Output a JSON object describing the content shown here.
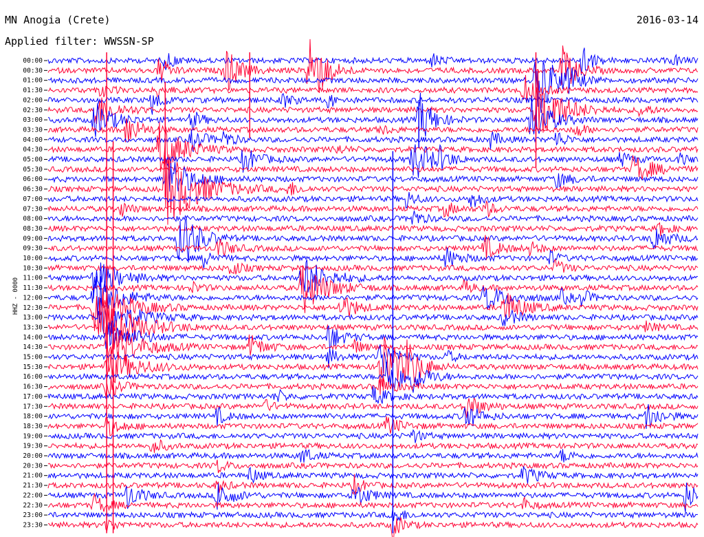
{
  "header": {
    "station": "MN Anogia (Crete)",
    "filter": "Applied filter: WWSSN-SP",
    "date": "2016-03-14",
    "channel": "HHZ - 0000"
  },
  "colors": {
    "odd_row": "#0000ff",
    "even_row": "#ff0033"
  },
  "chart_data": {
    "type": "line",
    "title": "MN Anogia (Crete)",
    "subtitle": "Applied filter: WWSSN-SP",
    "ylabel": "HHZ - 0000",
    "xlabel": "",
    "row_labels": [
      "00:00",
      "00:30",
      "01:00",
      "01:30",
      "02:00",
      "02:30",
      "03:00",
      "03:30",
      "04:00",
      "04:30",
      "05:00",
      "05:30",
      "06:00",
      "06:30",
      "07:00",
      "07:30",
      "08:00",
      "08:30",
      "09:00",
      "09:30",
      "10:00",
      "10:30",
      "11:00",
      "11:30",
      "12:00",
      "12:30",
      "13:00",
      "13:30",
      "14:00",
      "14:30",
      "15:00",
      "15:30",
      "16:00",
      "16:30",
      "17:00",
      "17:30",
      "18:00",
      "18:30",
      "19:00",
      "19:30",
      "20:00",
      "20:30",
      "21:00",
      "21:30",
      "22:00",
      "22:30",
      "23:00",
      "23:30"
    ],
    "row_minutes": 30,
    "series_colors": [
      "#0000ff",
      "#ff0033"
    ],
    "events": [
      {
        "row": 0,
        "t": 0.82,
        "amp": 28,
        "len": 0.02
      },
      {
        "row": 0,
        "t": 0.18,
        "amp": 14,
        "len": 0.02
      },
      {
        "row": 0,
        "t": 0.59,
        "amp": 10,
        "len": 0.02
      },
      {
        "row": 0,
        "t": 0.96,
        "amp": 8,
        "len": 0.02
      },
      {
        "row": 1,
        "t": 0.27,
        "amp": 40,
        "len": 0.03
      },
      {
        "row": 1,
        "t": 0.4,
        "amp": 80,
        "len": 0.03
      },
      {
        "row": 1,
        "t": 0.17,
        "amp": 22,
        "len": 0.02
      },
      {
        "row": 1,
        "t": 0.79,
        "amp": 36,
        "len": 0.03
      },
      {
        "row": 2,
        "t": 0.75,
        "amp": 60,
        "len": 0.04
      },
      {
        "row": 2,
        "t": 0.8,
        "amp": 16,
        "len": 0.02
      },
      {
        "row": 3,
        "t": 0.08,
        "amp": 10,
        "len": 0.02
      },
      {
        "row": 3,
        "t": 0.17,
        "amp": 10,
        "len": 0.02
      },
      {
        "row": 3,
        "t": 0.73,
        "amp": 24,
        "len": 0.03
      },
      {
        "row": 4,
        "t": 0.16,
        "amp": 20,
        "len": 0.02
      },
      {
        "row": 4,
        "t": 0.36,
        "amp": 12,
        "len": 0.02
      },
      {
        "row": 4,
        "t": 0.43,
        "amp": 10,
        "len": 0.02
      },
      {
        "row": 5,
        "t": 0.07,
        "amp": 28,
        "len": 0.04
      },
      {
        "row": 5,
        "t": 0.75,
        "amp": 62,
        "len": 0.05
      },
      {
        "row": 5,
        "t": 0.91,
        "amp": 10,
        "len": 0.02
      },
      {
        "row": 6,
        "t": 0.07,
        "amp": 28,
        "len": 0.04
      },
      {
        "row": 6,
        "t": 0.22,
        "amp": 16,
        "len": 0.02
      },
      {
        "row": 6,
        "t": 0.74,
        "amp": 40,
        "len": 0.04
      },
      {
        "row": 6,
        "t": 0.57,
        "amp": 40,
        "len": 0.03
      },
      {
        "row": 7,
        "t": 0.12,
        "amp": 24,
        "len": 0.03
      },
      {
        "row": 7,
        "t": 0.51,
        "amp": 8,
        "len": 0.02
      },
      {
        "row": 7,
        "t": 0.81,
        "amp": 12,
        "len": 0.02
      },
      {
        "row": 8,
        "t": 0.22,
        "amp": 16,
        "len": 0.03
      },
      {
        "row": 8,
        "t": 0.27,
        "amp": 12,
        "len": 0.02
      },
      {
        "row": 8,
        "t": 0.68,
        "amp": 12,
        "len": 0.02
      },
      {
        "row": 8,
        "t": 0.78,
        "amp": 14,
        "len": 0.02
      },
      {
        "row": 9,
        "t": 0.17,
        "amp": 40,
        "len": 0.05
      },
      {
        "row": 9,
        "t": 0.44,
        "amp": 8,
        "len": 0.02
      },
      {
        "row": 10,
        "t": 0.3,
        "amp": 20,
        "len": 0.03
      },
      {
        "row": 10,
        "t": 0.56,
        "amp": 34,
        "len": 0.04
      },
      {
        "row": 10,
        "t": 0.6,
        "amp": 14,
        "len": 0.02
      },
      {
        "row": 10,
        "t": 0.88,
        "amp": 12,
        "len": 0.02
      },
      {
        "row": 10,
        "t": 0.97,
        "amp": 8,
        "len": 0.02
      },
      {
        "row": 11,
        "t": 0.9,
        "amp": 22,
        "len": 0.04
      },
      {
        "row": 12,
        "t": 0.18,
        "amp": 40,
        "len": 0.05
      },
      {
        "row": 12,
        "t": 0.78,
        "amp": 12,
        "len": 0.03
      },
      {
        "row": 13,
        "t": 0.18,
        "amp": 60,
        "len": 0.07
      },
      {
        "row": 13,
        "t": 0.37,
        "amp": 12,
        "len": 0.02
      },
      {
        "row": 14,
        "t": 0.55,
        "amp": 14,
        "len": 0.02
      },
      {
        "row": 14,
        "t": 0.65,
        "amp": 14,
        "len": 0.02
      },
      {
        "row": 15,
        "t": 0.11,
        "amp": 12,
        "len": 0.02
      },
      {
        "row": 15,
        "t": 0.61,
        "amp": 12,
        "len": 0.02
      },
      {
        "row": 15,
        "t": 0.67,
        "amp": 14,
        "len": 0.02
      },
      {
        "row": 16,
        "t": 0.56,
        "amp": 14,
        "len": 0.02
      },
      {
        "row": 17,
        "t": 0.94,
        "amp": 10,
        "len": 0.02
      },
      {
        "row": 18,
        "t": 0.2,
        "amp": 30,
        "len": 0.04
      },
      {
        "row": 18,
        "t": 0.21,
        "amp": 22,
        "len": 0.03
      },
      {
        "row": 18,
        "t": 0.93,
        "amp": 20,
        "len": 0.03
      },
      {
        "row": 19,
        "t": 0.26,
        "amp": 14,
        "len": 0.03
      },
      {
        "row": 19,
        "t": 0.67,
        "amp": 18,
        "len": 0.03
      },
      {
        "row": 19,
        "t": 0.74,
        "amp": 10,
        "len": 0.02
      },
      {
        "row": 20,
        "t": 0.24,
        "amp": 14,
        "len": 0.02
      },
      {
        "row": 20,
        "t": 0.61,
        "amp": 16,
        "len": 0.03
      },
      {
        "row": 20,
        "t": 0.77,
        "amp": 10,
        "len": 0.02
      },
      {
        "row": 21,
        "t": 0.28,
        "amp": 14,
        "len": 0.02
      },
      {
        "row": 21,
        "t": 0.78,
        "amp": 12,
        "len": 0.02
      },
      {
        "row": 22,
        "t": 0.39,
        "amp": 34,
        "len": 0.05
      },
      {
        "row": 22,
        "t": 0.07,
        "amp": 30,
        "len": 0.05
      },
      {
        "row": 23,
        "t": 0.39,
        "amp": 40,
        "len": 0.05
      },
      {
        "row": 23,
        "t": 0.22,
        "amp": 8,
        "len": 0.02
      },
      {
        "row": 23,
        "t": 0.64,
        "amp": 10,
        "len": 0.02
      },
      {
        "row": 24,
        "t": 0.07,
        "amp": 40,
        "len": 0.05
      },
      {
        "row": 24,
        "t": 0.67,
        "amp": 20,
        "len": 0.05
      },
      {
        "row": 24,
        "t": 0.79,
        "amp": 10,
        "len": 0.02
      },
      {
        "row": 24,
        "t": 0.82,
        "amp": 12,
        "len": 0.02
      },
      {
        "row": 25,
        "t": 0.07,
        "amp": 50,
        "len": 0.06
      },
      {
        "row": 25,
        "t": 0.45,
        "amp": 22,
        "len": 0.03
      },
      {
        "row": 25,
        "t": 0.7,
        "amp": 26,
        "len": 0.04
      },
      {
        "row": 26,
        "t": 0.08,
        "amp": 40,
        "len": 0.06
      },
      {
        "row": 26,
        "t": 0.7,
        "amp": 14,
        "len": 0.03
      },
      {
        "row": 27,
        "t": 0.08,
        "amp": 50,
        "len": 0.07
      },
      {
        "row": 27,
        "t": 0.92,
        "amp": 8,
        "len": 0.02
      },
      {
        "row": 28,
        "t": 0.43,
        "amp": 20,
        "len": 0.03
      },
      {
        "row": 28,
        "t": 0.09,
        "amp": 30,
        "len": 0.05
      },
      {
        "row": 29,
        "t": 0.31,
        "amp": 18,
        "len": 0.03
      },
      {
        "row": 29,
        "t": 0.47,
        "amp": 10,
        "len": 0.02
      },
      {
        "row": 29,
        "t": 0.09,
        "amp": 40,
        "len": 0.06
      },
      {
        "row": 30,
        "t": 0.43,
        "amp": 14,
        "len": 0.02
      },
      {
        "row": 30,
        "t": 0.61,
        "amp": 10,
        "len": 0.02
      },
      {
        "row": 30,
        "t": 0.51,
        "amp": 30,
        "len": 0.03
      },
      {
        "row": 31,
        "t": 0.09,
        "amp": 30,
        "len": 0.06
      },
      {
        "row": 31,
        "t": 0.51,
        "amp": 60,
        "len": 0.04
      },
      {
        "row": 31,
        "t": 0.55,
        "amp": 30,
        "len": 0.03
      },
      {
        "row": 32,
        "t": 0.52,
        "amp": 30,
        "len": 0.04
      },
      {
        "row": 32,
        "t": 0.56,
        "amp": 18,
        "len": 0.03
      },
      {
        "row": 33,
        "t": 0.09,
        "amp": 16,
        "len": 0.03
      },
      {
        "row": 33,
        "t": 0.51,
        "amp": 14,
        "len": 0.03
      },
      {
        "row": 34,
        "t": 0.35,
        "amp": 10,
        "len": 0.02
      },
      {
        "row": 34,
        "t": 0.5,
        "amp": 14,
        "len": 0.03
      },
      {
        "row": 35,
        "t": 0.33,
        "amp": 10,
        "len": 0.02
      },
      {
        "row": 35,
        "t": 0.64,
        "amp": 22,
        "len": 0.03
      },
      {
        "row": 36,
        "t": 0.64,
        "amp": 22,
        "len": 0.03
      },
      {
        "row": 36,
        "t": 0.92,
        "amp": 20,
        "len": 0.03
      },
      {
        "row": 36,
        "t": 0.26,
        "amp": 12,
        "len": 0.02
      },
      {
        "row": 37,
        "t": 0.09,
        "amp": 14,
        "len": 0.03
      },
      {
        "row": 37,
        "t": 0.52,
        "amp": 14,
        "len": 0.03
      },
      {
        "row": 38,
        "t": 0.56,
        "amp": 10,
        "len": 0.02
      },
      {
        "row": 39,
        "t": 0.16,
        "amp": 14,
        "len": 0.02
      },
      {
        "row": 40,
        "t": 0.39,
        "amp": 14,
        "len": 0.02
      },
      {
        "row": 40,
        "t": 0.79,
        "amp": 10,
        "len": 0.02
      },
      {
        "row": 41,
        "t": 0.26,
        "amp": 10,
        "len": 0.02
      },
      {
        "row": 42,
        "t": 0.31,
        "amp": 12,
        "len": 0.02
      },
      {
        "row": 42,
        "t": 0.73,
        "amp": 14,
        "len": 0.03
      },
      {
        "row": 43,
        "t": 0.26,
        "amp": 10,
        "len": 0.02
      },
      {
        "row": 43,
        "t": 0.47,
        "amp": 14,
        "len": 0.02
      },
      {
        "row": 44,
        "t": 0.12,
        "amp": 20,
        "len": 0.03
      },
      {
        "row": 44,
        "t": 0.26,
        "amp": 24,
        "len": 0.03
      },
      {
        "row": 44,
        "t": 0.47,
        "amp": 20,
        "len": 0.03
      },
      {
        "row": 44,
        "t": 0.98,
        "amp": 24,
        "len": 0.02
      },
      {
        "row": 45,
        "t": 0.07,
        "amp": 14,
        "len": 0.03
      },
      {
        "row": 45,
        "t": 0.73,
        "amp": 10,
        "len": 0.02
      },
      {
        "row": 46,
        "t": 0.53,
        "amp": 16,
        "len": 0.02
      },
      {
        "row": 47,
        "t": 0.09,
        "amp": 10,
        "len": 0.02
      },
      {
        "row": 47,
        "t": 0.53,
        "amp": 20,
        "len": 0.02
      }
    ],
    "vertical_spikes": [
      {
        "t": 0.09,
        "from_row": 0,
        "to_row": 47,
        "color": "#ff0033"
      },
      {
        "t": 0.31,
        "from_row": 0,
        "to_row": 7,
        "color": "#ff0033"
      },
      {
        "t": 0.53,
        "from_row": 10,
        "to_row": 47,
        "color": "#0000ff"
      },
      {
        "t": 0.75,
        "from_row": 0,
        "to_row": 10,
        "color": "#ff0033"
      },
      {
        "t": 0.57,
        "from_row": 5,
        "to_row": 8,
        "color": "#0000ff"
      },
      {
        "t": 0.18,
        "from_row": 3,
        "to_row": 13,
        "color": "#ff0033"
      },
      {
        "t": 0.1,
        "from_row": 9,
        "to_row": 47,
        "color": "#ff0033"
      }
    ]
  }
}
